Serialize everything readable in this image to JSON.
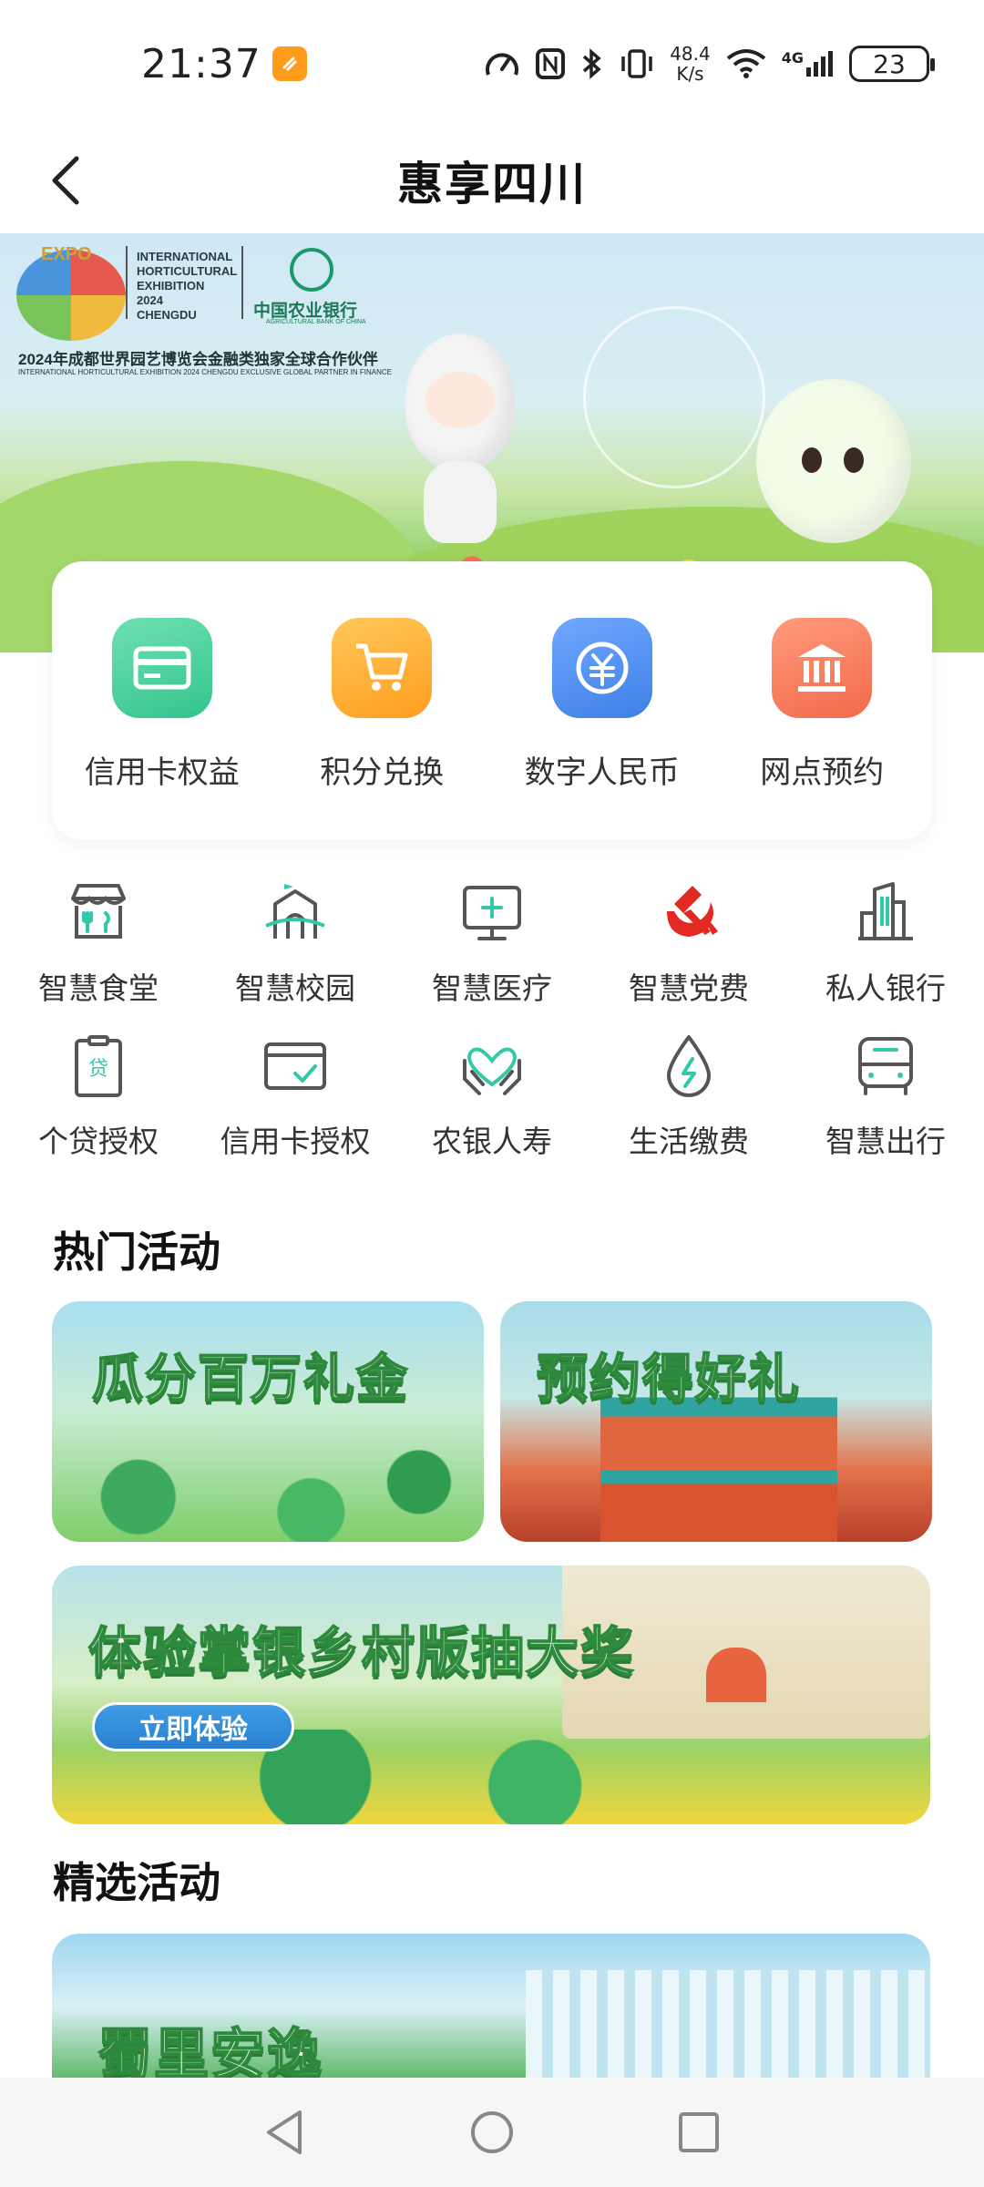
{
  "status_bar": {
    "time": "21:37",
    "net_speed_value": "48.4",
    "net_speed_unit": "K/s",
    "network": "4G",
    "battery": "23"
  },
  "header": {
    "title": "惠享四川"
  },
  "banner": {
    "expo_text": "EXPO",
    "intl_line1": "INTERNATIONAL",
    "intl_line2": "HORTICULTURAL",
    "intl_line3": "EXHIBITION",
    "intl_line4": "2024",
    "intl_line5": "CHENGDU",
    "bank_name": "中国农业银行",
    "bank_name_en": "AGRICULTURAL BANK OF CHINA",
    "partner_text": "2024年成都世界园艺博览会金融类独家全球合作伙伴",
    "partner_text_en": "INTERNATIONAL HORTICULTURAL EXHIBITION 2024 CHENGDU EXCLUSIVE GLOBAL PARTNER IN FINANCE"
  },
  "quick_actions": [
    {
      "label": "信用卡权益",
      "icon": "credit-card-icon",
      "color": "#3fcf96"
    },
    {
      "label": "积分兑换",
      "icon": "shopping-cart-icon",
      "color": "#ffae2a"
    },
    {
      "label": "数字人民币",
      "icon": "digital-rmb-icon",
      "color": "#4c8df2"
    },
    {
      "label": "网点预约",
      "icon": "bank-building-icon",
      "color": "#f7785a"
    }
  ],
  "services_row1": [
    {
      "label": "智慧食堂",
      "icon": "canteen-icon"
    },
    {
      "label": "智慧校园",
      "icon": "campus-icon"
    },
    {
      "label": "智慧医疗",
      "icon": "medical-icon"
    },
    {
      "label": "智慧党费",
      "icon": "party-emblem-icon"
    },
    {
      "label": "私人银行",
      "icon": "private-bank-icon"
    }
  ],
  "services_row2": [
    {
      "label": "个贷授权",
      "icon": "loan-document-icon",
      "badge": "贷"
    },
    {
      "label": "信用卡授权",
      "icon": "card-auth-icon"
    },
    {
      "label": "农银人寿",
      "icon": "heart-hands-icon"
    },
    {
      "label": "生活缴费",
      "icon": "utility-drop-icon"
    },
    {
      "label": "智慧出行",
      "icon": "bus-icon"
    }
  ],
  "hot_section": {
    "title": "热门活动",
    "cards": [
      {
        "title": "瓜分百万礼金"
      },
      {
        "title": "预约得好礼"
      },
      {
        "title": "体验掌银乡村版抽大奖",
        "button": "立即体验"
      }
    ]
  },
  "featured_section": {
    "title": "精选活动",
    "cards": [
      {
        "title": "蜀里安逸"
      }
    ]
  },
  "colors": {
    "accent_green": "#2ea886",
    "icon_teal": "#34c7a8",
    "party_red": "#e22a22"
  }
}
